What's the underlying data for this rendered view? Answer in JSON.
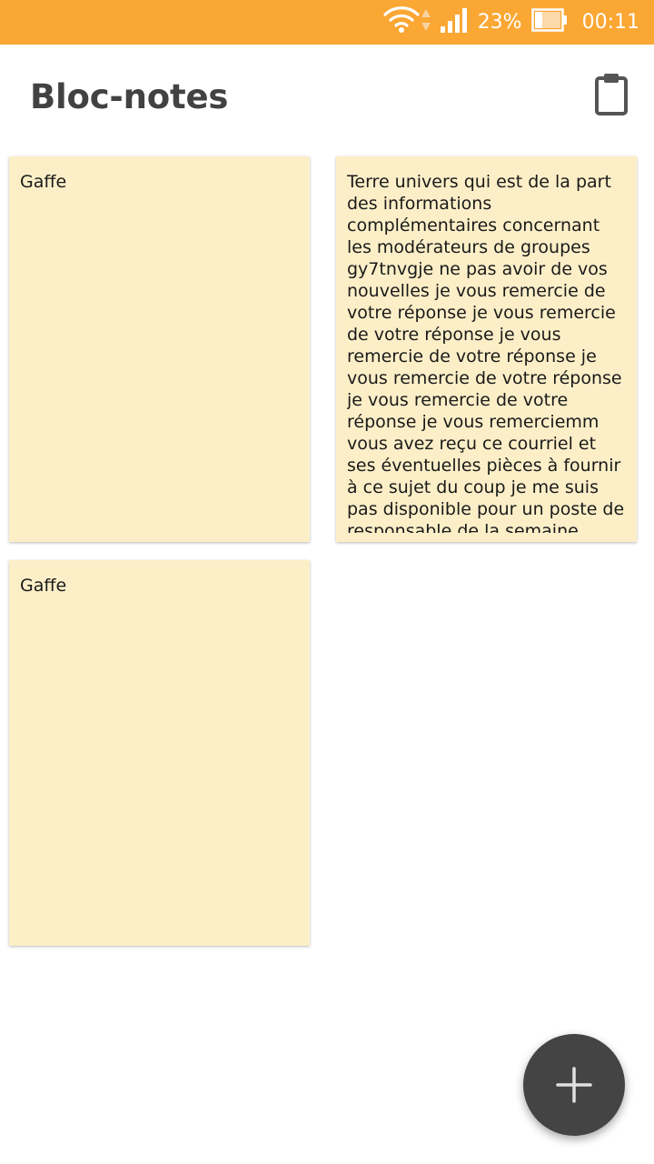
{
  "status_bar": {
    "battery_percent": "23%",
    "time": "00:11",
    "background_color": "#fba733",
    "icons": [
      "wifi-icon",
      "data-transfer-icon",
      "cell-signal-icon",
      "battery-icon"
    ]
  },
  "app_bar": {
    "title": "Bloc-notes",
    "action_icon": "clipboard-icon"
  },
  "notes": [
    {
      "text": "Gaffe"
    },
    {
      "text": "Terre univers qui est de la part des informations complémentaires concernant les modérateurs de groupes gy7tnvgje ne pas avoir de vos nouvelles je vous remercie de votre réponse je vous remercie de votre réponse je vous remercie de votre réponse je vous remercie de votre réponse je vous remercie de votre réponse je vous remerciemm vous avez reçu ce courriel et ses éventuelles pièces à fournir à ce sujet du coup je me suis pas disponible pour un poste de responsable de la semaine prochaine pour le moment je suis"
    },
    {
      "text": "Gaffe"
    }
  ],
  "note_color": "#fcefc8",
  "fab": {
    "icon": "plus-icon",
    "color": "#444444"
  }
}
